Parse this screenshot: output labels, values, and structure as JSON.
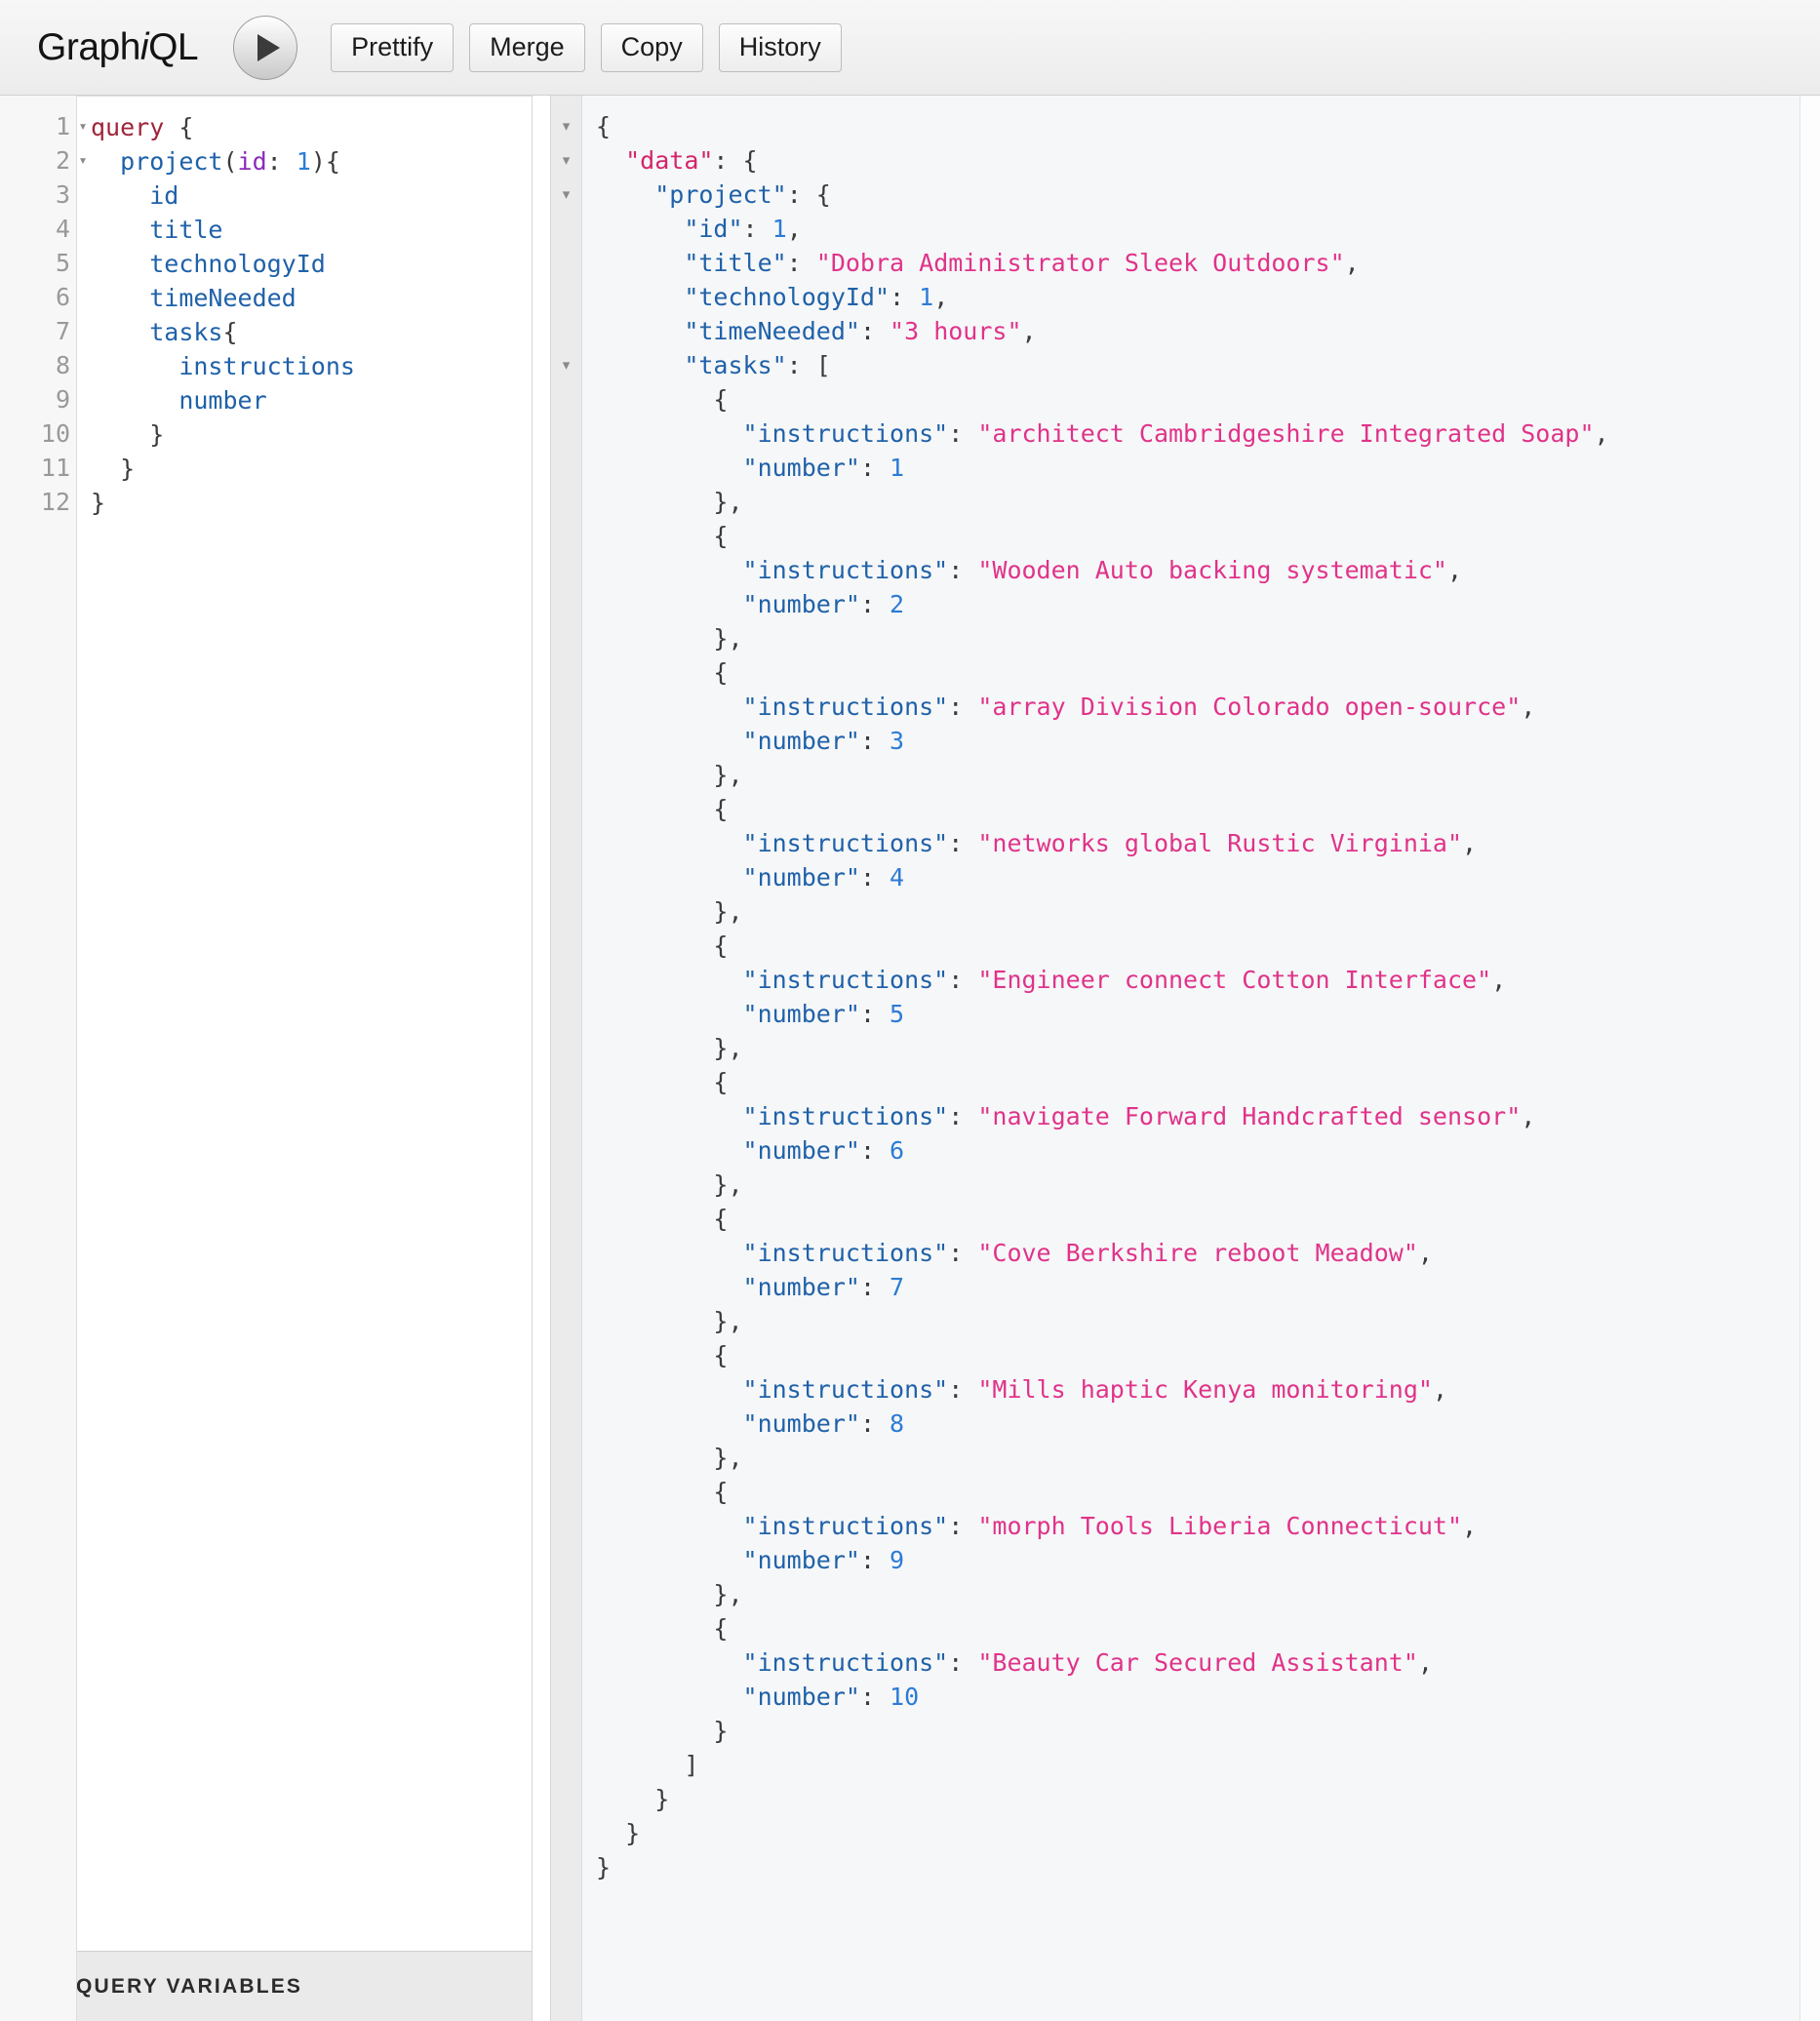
{
  "app": {
    "brand_prefix": "Graph",
    "brand_italic": "i",
    "brand_suffix": "QL"
  },
  "toolbar": {
    "execute_label": "▶",
    "execute_name": "execute-query-button",
    "buttons": [
      {
        "label": "Prettify",
        "name": "prettify-button"
      },
      {
        "label": "Merge",
        "name": "merge-button"
      },
      {
        "label": "Copy",
        "name": "copy-button"
      },
      {
        "label": "History",
        "name": "history-button"
      }
    ]
  },
  "editor": {
    "fold_marker": "▾",
    "line_numbers": [
      "1",
      "2",
      "3",
      "4",
      "5",
      "6",
      "7",
      "8",
      "9",
      "10",
      "11",
      "12"
    ],
    "folds": [
      true,
      true,
      false,
      false,
      false,
      false,
      false,
      false,
      false,
      false,
      false,
      false
    ],
    "lines": [
      "query {",
      "  project(id: 1){",
      "    id",
      "    title",
      "    technologyId",
      "    timeNeeded",
      "    tasks{",
      "      instructions",
      "      number",
      "    }",
      "  }",
      "}"
    ]
  },
  "query_variables": {
    "label": "QUERY VARIABLES"
  },
  "result": {
    "fold_marker": "▾",
    "fold_rows": [
      1,
      2,
      3,
      8
    ],
    "root_key": "data",
    "project_key": "project",
    "fields": {
      "id_key": "id",
      "id_value": 1,
      "title_key": "title",
      "title_value": "Dobra Administrator Sleek Outdoors",
      "technologyId_key": "technologyId",
      "technologyId_value": 1,
      "timeNeeded_key": "timeNeeded",
      "timeNeeded_value": "3 hours",
      "tasks_key": "tasks",
      "instructions_key": "instructions",
      "number_key": "number"
    },
    "tasks": [
      {
        "instructions": "architect Cambridgeshire Integrated Soap",
        "number": 1
      },
      {
        "instructions": "Wooden Auto backing systematic",
        "number": 2
      },
      {
        "instructions": "array Division Colorado open-source",
        "number": 3
      },
      {
        "instructions": "networks global Rustic Virginia",
        "number": 4
      },
      {
        "instructions": "Engineer connect Cotton Interface",
        "number": 5
      },
      {
        "instructions": "navigate Forward Handcrafted sensor",
        "number": 6
      },
      {
        "instructions": "Cove Berkshire reboot Meadow",
        "number": 7
      },
      {
        "instructions": "Mills haptic Kenya monitoring",
        "number": 8
      },
      {
        "instructions": "morph Tools Liberia Connecticut",
        "number": 9
      },
      {
        "instructions": "Beauty Car Secured Assistant",
        "number": 10
      }
    ]
  },
  "colors": {
    "keyword": "#a0243a",
    "field": "#1f61a9",
    "argument": "#8b2bb9",
    "number": "#2c7bd6",
    "json_root_key": "#d4246a",
    "json_key": "#1f61a9",
    "json_string": "#e0338a",
    "toolbar_bg": "#ececec",
    "result_bg": "#f6f7f8"
  }
}
